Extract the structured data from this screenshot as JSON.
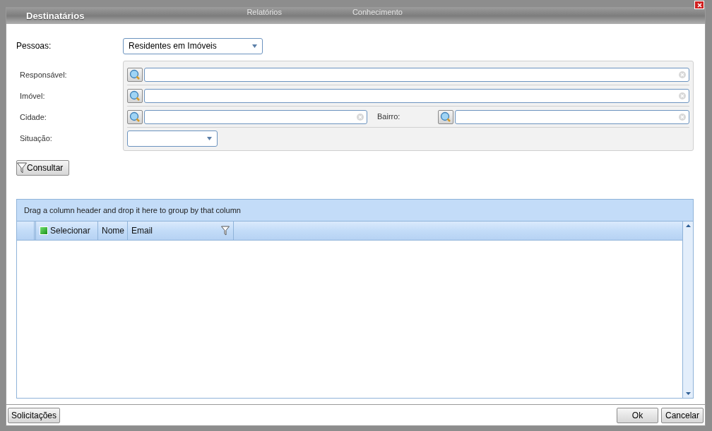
{
  "window": {
    "title": "Destinatários",
    "background_texts": [
      "Relatórios",
      "Conhecimento"
    ]
  },
  "pessoas": {
    "label": "Pessoas:",
    "value": "Residentes em Imóveis"
  },
  "filters": [
    {
      "kind": "lookup",
      "label": "Responsável:"
    },
    {
      "kind": "lookup",
      "label": "Imóvel:"
    },
    {
      "kind": "lookup_pair",
      "label": "Cidade:",
      "label_2": "Bairro:"
    },
    {
      "kind": "select",
      "label": "Situação:"
    }
  ],
  "consultar_button": "Consultar",
  "grid": {
    "group_hint": "Drag a column header and drop it here to group by that column",
    "columns": [
      {
        "kind": "check",
        "label": "Selecionar",
        "checked": true
      },
      {
        "kind": "text",
        "label": "Nome"
      },
      {
        "kind": "filter",
        "label": "Email"
      }
    ]
  },
  "footer": {
    "left_button": "Solicitações",
    "buttons": [
      "Ok",
      "Cancelar"
    ]
  }
}
